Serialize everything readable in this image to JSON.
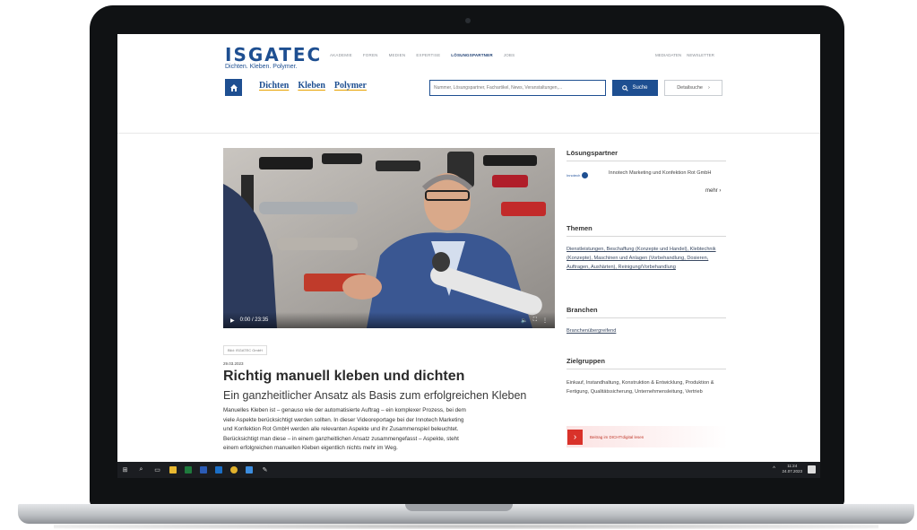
{
  "site": {
    "logo": "ISGATEC",
    "tagline": "Dichten. Kleben. Polymer.",
    "top_nav": [
      "Akademie",
      "Foren",
      "Medien",
      "Expertise",
      "Lösungspartner",
      "Jobs"
    ],
    "top_links": [
      "Mediadaten",
      "Newsletter"
    ],
    "categories": [
      "Dichten",
      "Kleben",
      "Polymer"
    ],
    "home_icon": "home-icon",
    "search": {
      "placeholder": "Nummer, Lösungspartner, Fachartikel, News, Veranstaltungen,...",
      "button": "Suche",
      "detail_button": "Detailsuche"
    }
  },
  "video": {
    "time": "0:00 / 23:35",
    "credit": "Bild: ISGATEC GmbH"
  },
  "article": {
    "date": "29.03.2023",
    "title": "Richtig manuell kleben und dichten",
    "subtitle": "Ein ganzheitlicher Ansatz als Basis zum erfolgreichen Kleben",
    "lines": [
      "Manuelles Kleben ist – genauso wie der automatisierte Auftrag – ein komplexer Prozess, bei dem",
      "viele Aspekte berücksichtigt werden sollten. In dieser Videoreportage bei der Innotech Marketing",
      "und Konfektion Rot GmbH werden alle relevanten Aspekte und ihr Zusammenspiel beleuchtet.",
      "Berücksichtigt man diese – in einem ganzheitlichen Ansatz zusammengefasst – Aspekte, steht",
      "einem erfolgreichen manuellen Kleben eigentlich nichts mehr im Weg."
    ]
  },
  "sidebar": {
    "partner_heading": "Lösungspartner",
    "partner_logo_text": "Innotech",
    "partner_name": "Innotech Marketing und Konfektion Rot GmbH",
    "more": "mehr",
    "themen_heading": "Themen",
    "themen": "Dienstleistungen, Beschaffung (Konzepte und Handel), Klebtechnik (Konzepte), Maschinen und Anlagen (Vorbehandlung, Dosieren, Auftragen, Aushärten), Reinigung/Vorbehandlung",
    "branchen_heading": "Branchen",
    "branchen": "Branchenübergreifend",
    "zielgruppen_heading": "Zielgruppen",
    "zielgruppen": "Einkauf, Instandhaltung, Konstruktion & Entwicklung, Produktion & Fertigung, Qualitätssicherung, Unternehmensleitung, Vertrieb",
    "cta_label": "Beitrag im DICHT!digital lesen"
  },
  "taskbar": {
    "time": "11:24",
    "date": "24.07.2023"
  },
  "colors": {
    "brand_blue": "#1e4f91",
    "accent_red": "#d9322a",
    "accent_underline": "#e8a200"
  }
}
